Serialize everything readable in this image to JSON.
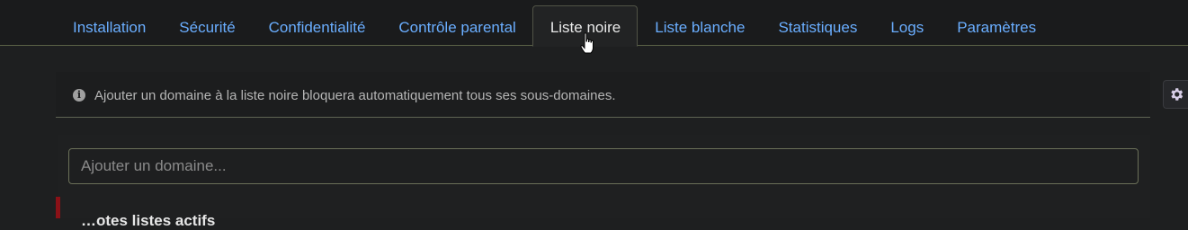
{
  "tabs": [
    {
      "label": "Installation",
      "active": false
    },
    {
      "label": "Sécurité",
      "active": false
    },
    {
      "label": "Confidentialité",
      "active": false
    },
    {
      "label": "Contrôle parental",
      "active": false
    },
    {
      "label": "Liste noire",
      "active": true
    },
    {
      "label": "Liste blanche",
      "active": false
    },
    {
      "label": "Statistiques",
      "active": false
    },
    {
      "label": "Logs",
      "active": false
    },
    {
      "label": "Paramètres",
      "active": false
    }
  ],
  "info": {
    "icon": "info-icon",
    "text": "Ajouter un domaine à la liste noire bloquera automatiquement tous ses sous-domaines."
  },
  "domain_input": {
    "placeholder": "Ajouter un domaine...",
    "value": ""
  },
  "section": {
    "label": "…otes listes actifs"
  },
  "colors": {
    "link": "#6aaeff",
    "accent_red": "#8b1117",
    "background": "#1e1f20"
  },
  "side_button": {
    "icon": "gear-icon"
  }
}
